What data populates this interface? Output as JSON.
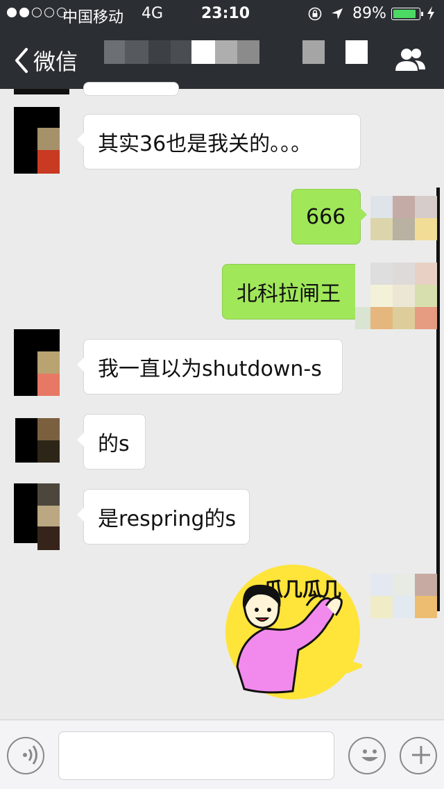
{
  "status_bar": {
    "carrier": "中国移动",
    "network": "4G",
    "time": "23:10",
    "battery_percent": "89%",
    "battery_level": 0.89,
    "signal_bars_filled": 2,
    "signal_bars_total": 5
  },
  "nav": {
    "back_label": "微信",
    "back_icon": "chevron-left-icon",
    "profile_icon": "people-icon"
  },
  "messages": [
    {
      "side": "left",
      "text": "其实36也是我关的。。。"
    },
    {
      "side": "right",
      "text": "666"
    },
    {
      "side": "right",
      "text": "北科拉闸王"
    },
    {
      "side": "left",
      "text": "我一直以为shutdown-s"
    },
    {
      "side": "left",
      "text": "的s"
    },
    {
      "side": "left",
      "text": "是respring的s"
    },
    {
      "side": "right",
      "type": "sticker",
      "text": "瓜几瓜几"
    }
  ],
  "input_bar": {
    "voice_icon": "voice-icon",
    "emoji_icon": "emoji-icon",
    "add_icon": "plus-icon",
    "text_value": ""
  },
  "colors": {
    "nav_bg": "#2b2f33",
    "chat_bg": "#ebebeb",
    "bubble_left": "#ffffff",
    "bubble_right": "#a0e75a",
    "battery_fill": "#4cd964"
  }
}
